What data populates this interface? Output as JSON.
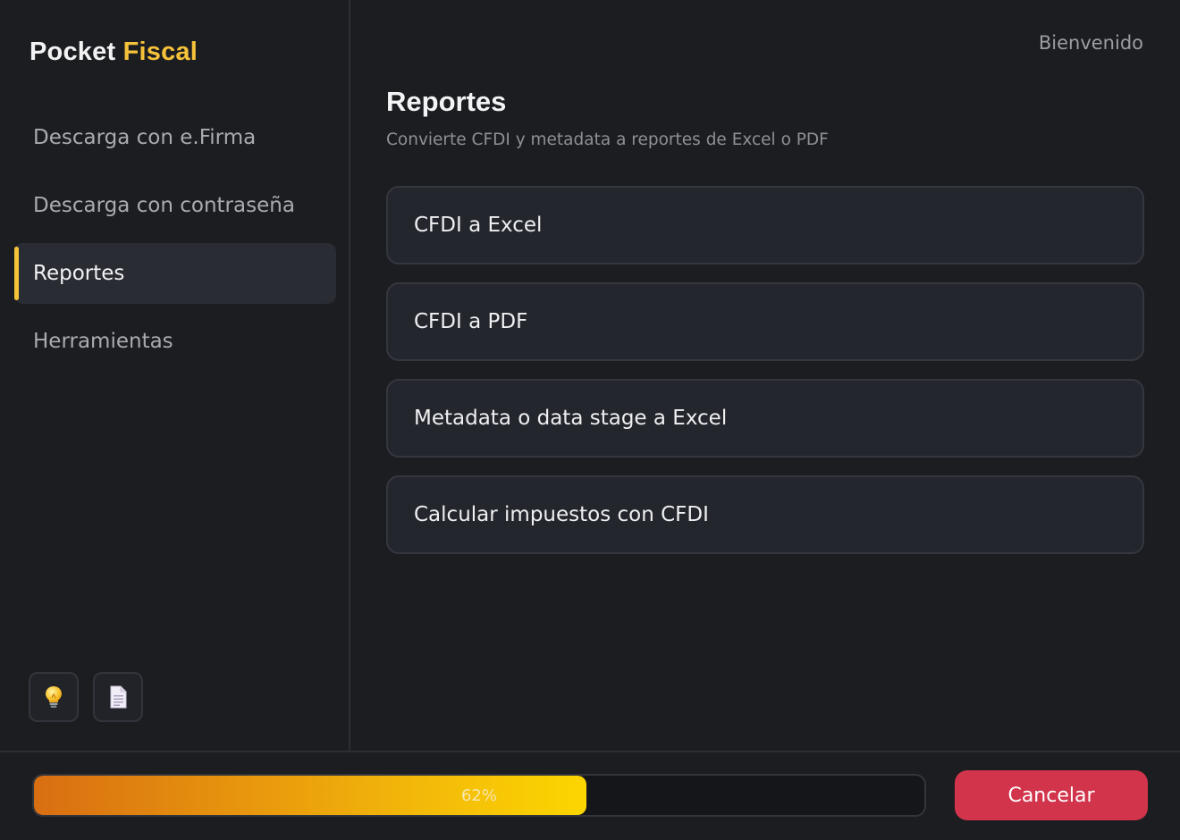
{
  "app": {
    "brand_part1": "Pocket",
    "brand_part2": "Fiscal",
    "accent_color": "#f6c23a"
  },
  "sidebar": {
    "items": [
      {
        "label": "Descarga con e.Firma",
        "active": false
      },
      {
        "label": "Descarga con contraseña",
        "active": false
      },
      {
        "label": "Reportes",
        "active": true
      },
      {
        "label": "Herramientas",
        "active": false
      }
    ],
    "tools": [
      {
        "icon": "lightbulb-icon"
      },
      {
        "icon": "document-icon"
      }
    ]
  },
  "header": {
    "welcome": "Bienvenido"
  },
  "main": {
    "title": "Reportes",
    "subtitle": "Convierte CFDI y metadata a reportes de Excel o PDF",
    "cards": [
      {
        "label": "CFDI a Excel"
      },
      {
        "label": "CFDI a PDF"
      },
      {
        "label": "Metadata o data stage a Excel"
      },
      {
        "label": "Calcular impuestos con CFDI"
      }
    ]
  },
  "footer": {
    "progress_percent": 62,
    "progress_label": "62%",
    "cancel_label": "Cancelar",
    "cancel_color": "#d1344b"
  }
}
